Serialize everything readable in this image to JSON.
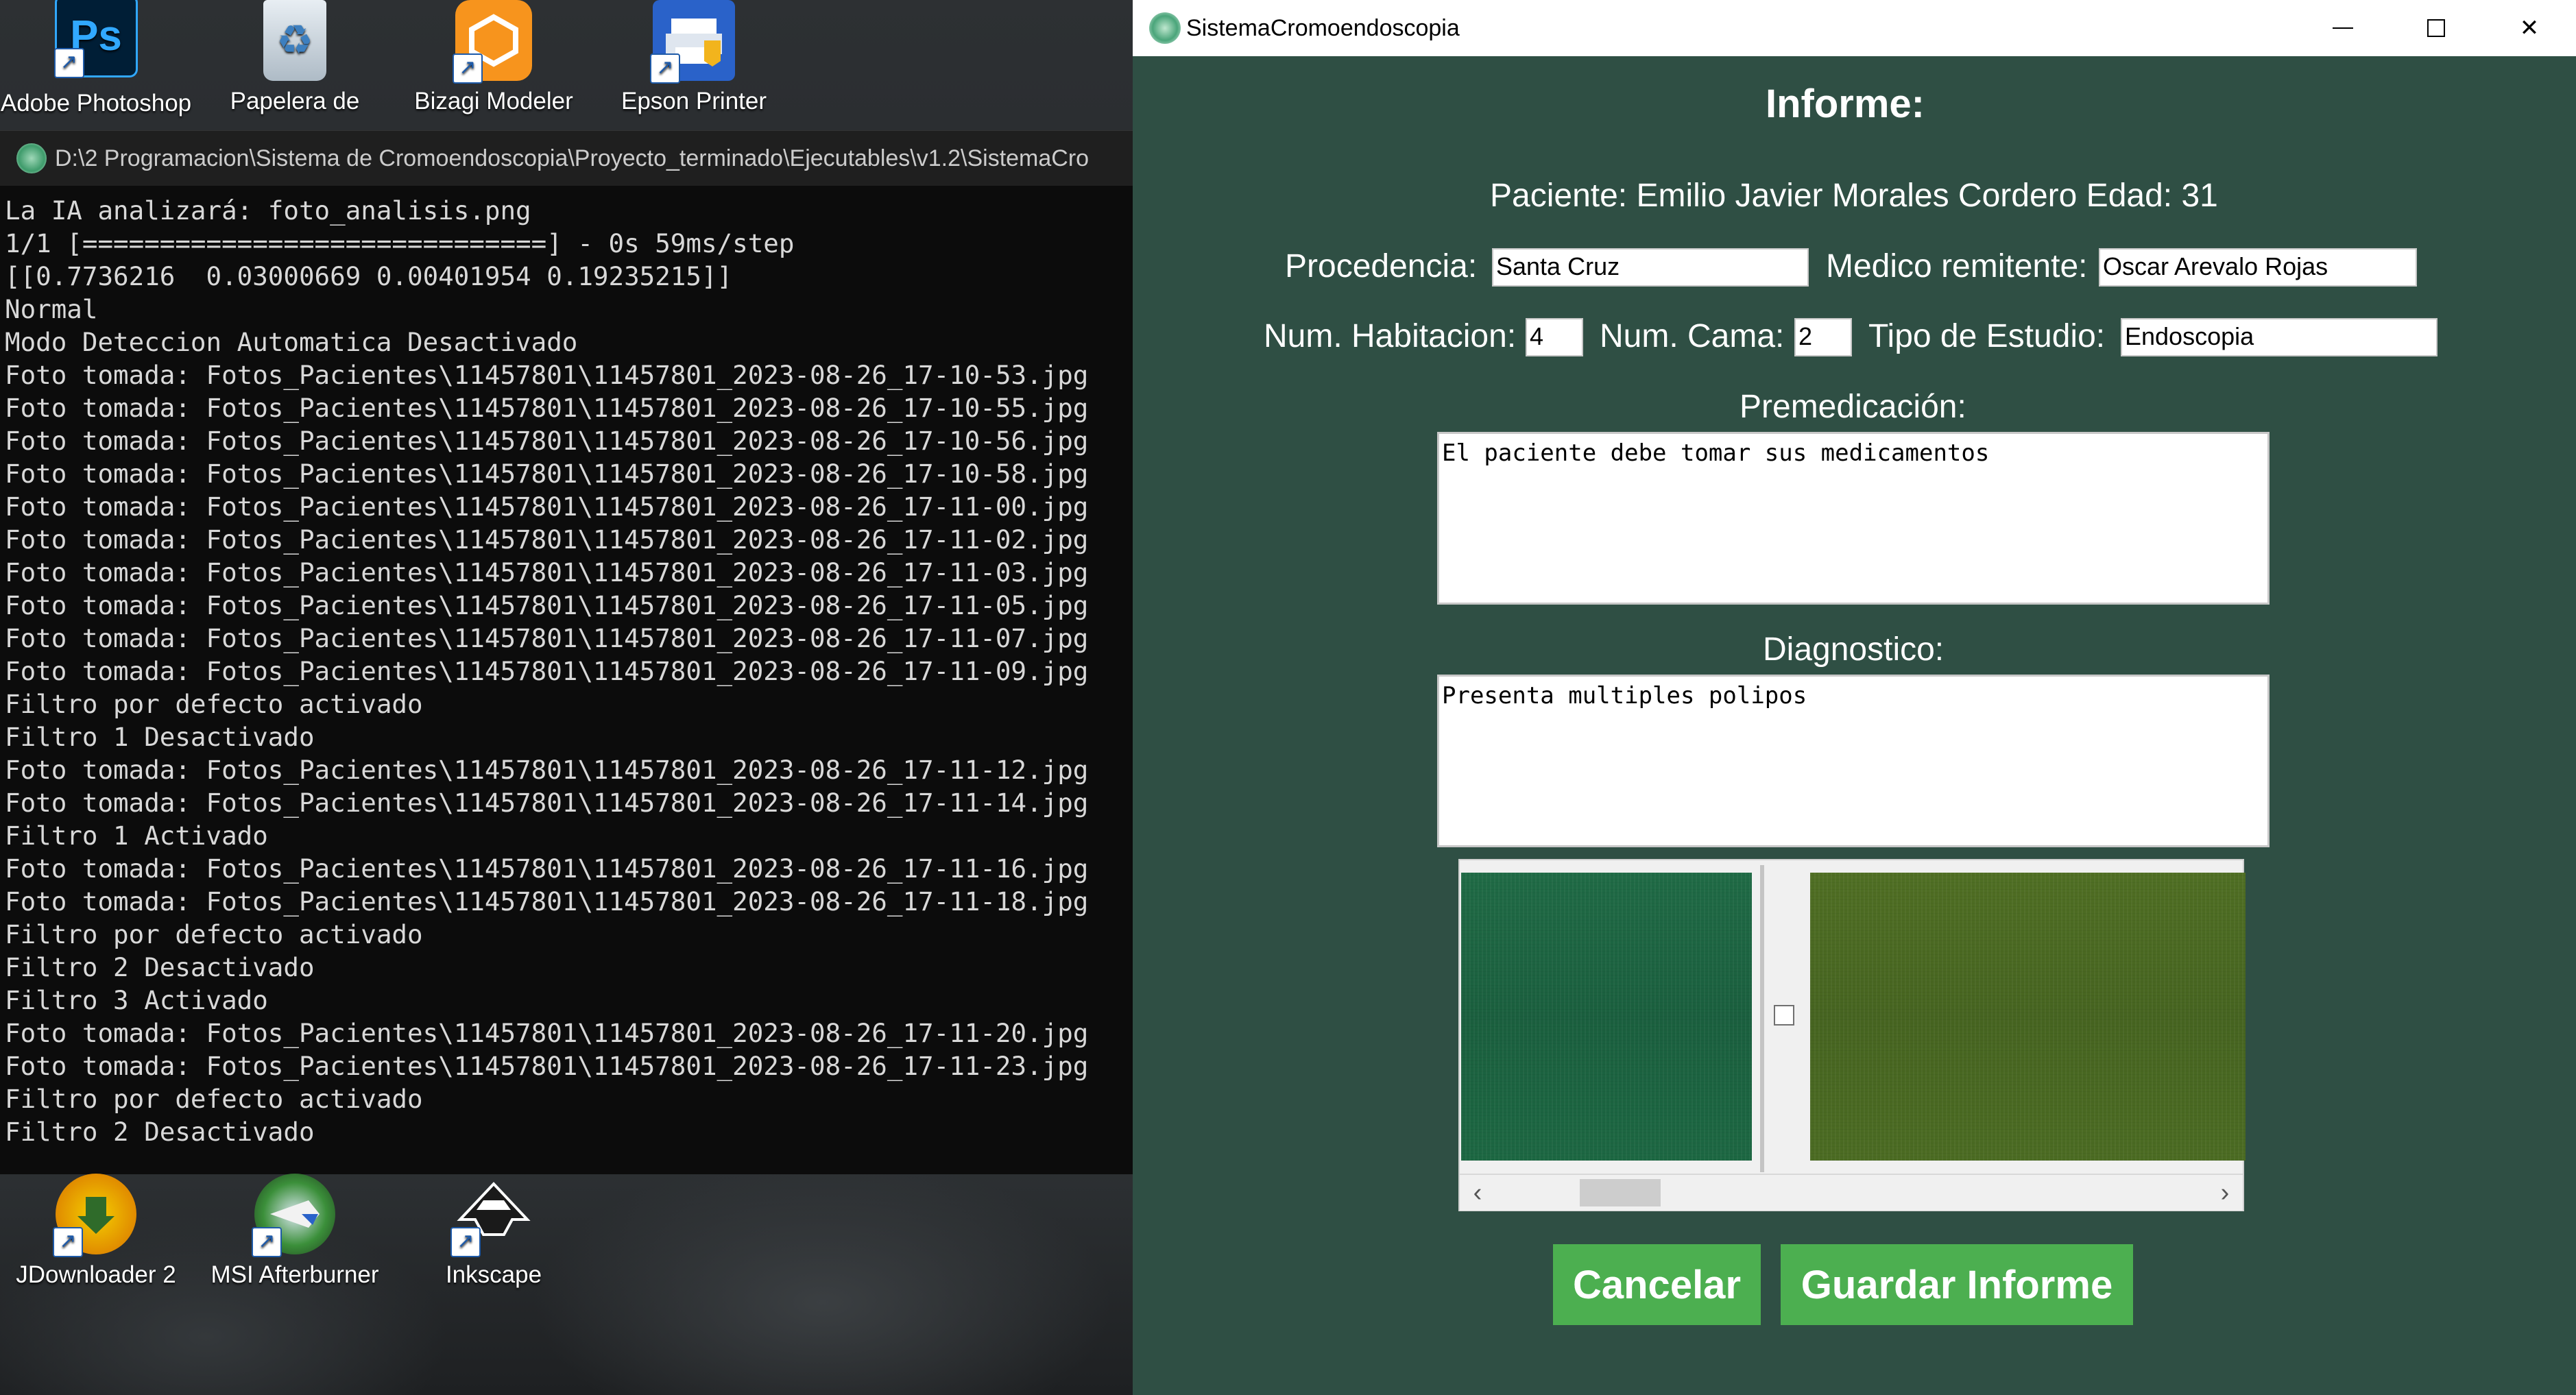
{
  "desktop": {
    "icons_top": [
      {
        "label": "Adobe Photoshop",
        "icon": "photoshop-icon"
      },
      {
        "label": "Papelera de",
        "icon": "recycle-bin-icon"
      },
      {
        "label": "Bizagi Modeler",
        "icon": "bizagi-icon"
      },
      {
        "label": "Epson Printer",
        "icon": "epson-printer-icon"
      }
    ],
    "icons_bottom": [
      {
        "label": "JDownloader 2",
        "icon": "jdownloader-icon"
      },
      {
        "label": "MSI Afterburner",
        "icon": "msi-afterburner-icon"
      },
      {
        "label": "Inkscape",
        "icon": "inkscape-icon"
      }
    ],
    "photoshop_glyph": "Ps"
  },
  "console": {
    "title": "D:\\2 Programacion\\Sistema de Cromoendoscopia\\Proyecto_terminado\\Ejecutables\\v1.2\\SistemaCro",
    "lines": [
      "La IA analizará: foto_analisis.png",
      "1/1 [==============================] - 0s 59ms/step",
      "[[0.7736216  0.03000669 0.00401954 0.19235215]]",
      "Normal",
      "Modo Deteccion Automatica Desactivado",
      "Foto tomada: Fotos_Pacientes\\11457801\\11457801_2023-08-26_17-10-53.jpg",
      "Foto tomada: Fotos_Pacientes\\11457801\\11457801_2023-08-26_17-10-55.jpg",
      "Foto tomada: Fotos_Pacientes\\11457801\\11457801_2023-08-26_17-10-56.jpg",
      "Foto tomada: Fotos_Pacientes\\11457801\\11457801_2023-08-26_17-10-58.jpg",
      "Foto tomada: Fotos_Pacientes\\11457801\\11457801_2023-08-26_17-11-00.jpg",
      "Foto tomada: Fotos_Pacientes\\11457801\\11457801_2023-08-26_17-11-02.jpg",
      "Foto tomada: Fotos_Pacientes\\11457801\\11457801_2023-08-26_17-11-03.jpg",
      "Foto tomada: Fotos_Pacientes\\11457801\\11457801_2023-08-26_17-11-05.jpg",
      "Foto tomada: Fotos_Pacientes\\11457801\\11457801_2023-08-26_17-11-07.jpg",
      "Foto tomada: Fotos_Pacientes\\11457801\\11457801_2023-08-26_17-11-09.jpg",
      "Filtro por defecto activado",
      "Filtro 1 Desactivado",
      "Foto tomada: Fotos_Pacientes\\11457801\\11457801_2023-08-26_17-11-12.jpg",
      "Foto tomada: Fotos_Pacientes\\11457801\\11457801_2023-08-26_17-11-14.jpg",
      "Filtro 1 Activado",
      "Foto tomada: Fotos_Pacientes\\11457801\\11457801_2023-08-26_17-11-16.jpg",
      "Foto tomada: Fotos_Pacientes\\11457801\\11457801_2023-08-26_17-11-18.jpg",
      "Filtro por defecto activado",
      "Filtro 2 Desactivado",
      "Filtro 3 Activado",
      "Foto tomada: Fotos_Pacientes\\11457801\\11457801_2023-08-26_17-11-20.jpg",
      "Foto tomada: Fotos_Pacientes\\11457801\\11457801_2023-08-26_17-11-23.jpg",
      "Filtro por defecto activado",
      "Filtro 2 Desactivado"
    ]
  },
  "app": {
    "title": "SistemaCromoendoscopia",
    "window_controls": {
      "minimize": "minimize-icon",
      "maximize": "maximize-icon",
      "close": "✕"
    },
    "heading": "Informe:",
    "patient_line": "Paciente: Emilio Javier Morales Cordero Edad: 31",
    "procedencia_label": "Procedencia:",
    "procedencia_value": "Santa Cruz",
    "medico_label": "Medico remitente:",
    "medico_value": "Oscar Arevalo Rojas",
    "habitacion_label": "Num. Habitacion:",
    "habitacion_value": "4",
    "cama_label": "Num. Cama:",
    "cama_value": "2",
    "estudio_label": "Tipo de Estudio:",
    "estudio_value": "Endoscopia",
    "premedicacion_label": "Premedicación:",
    "premedicacion_value": "El paciente debe tomar sus medicamentos",
    "diagnostico_label": "Diagnostico:",
    "diagnostico_value": "Presenta multiples polipos",
    "scroll_left": "‹",
    "scroll_right": "›",
    "cancel_label": "Cancelar",
    "save_label": "Guardar Informe",
    "button_color": "#4caf50",
    "background_color": "#2f4f44"
  }
}
